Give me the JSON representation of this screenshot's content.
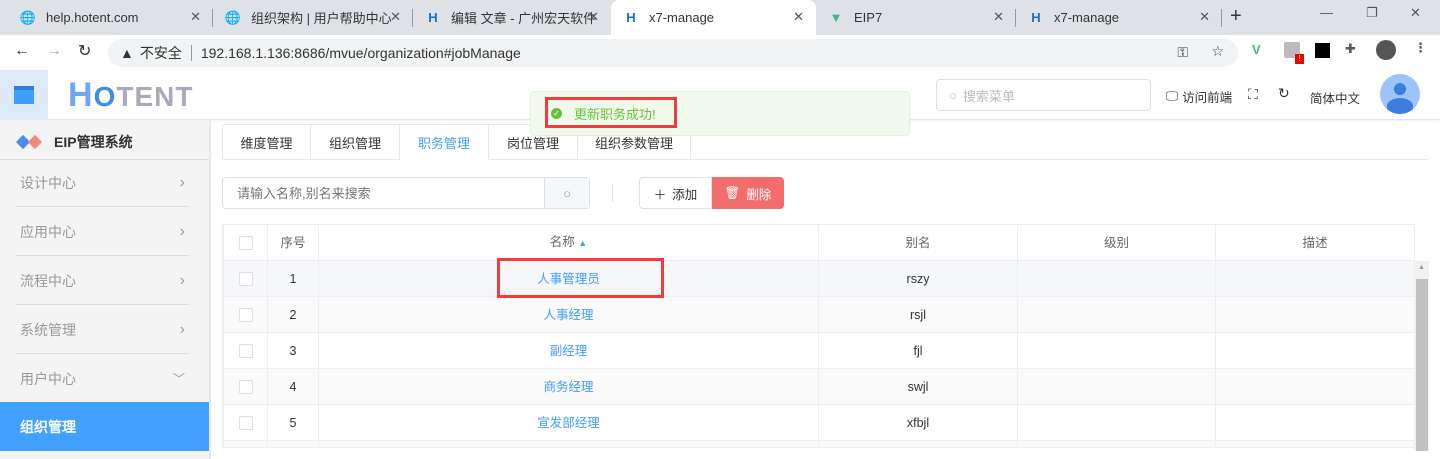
{
  "browser": {
    "tabs": [
      {
        "title": "help.hotent.com",
        "icon": "globe-icon"
      },
      {
        "title": "组织架构 | 用户帮助中心",
        "icon": "globe-icon"
      },
      {
        "title": "编辑 文章 - 广州宏天软件",
        "icon": "hotent-icon"
      },
      {
        "title": "x7-manage",
        "icon": "hotent-icon",
        "active": true
      },
      {
        "title": "EIP7",
        "icon": "vue-icon"
      },
      {
        "title": "x7-manage",
        "icon": "hotent-icon"
      }
    ],
    "security_label": "不安全",
    "url": "192.168.1.136:8686/mvue/organization#jobManage"
  },
  "header": {
    "logo": "HOTENT",
    "search_placeholder": "搜索菜单",
    "visit_frontend": "访问前端",
    "language": "简体中文"
  },
  "toast": {
    "message": "更新职务成功!",
    "color": "#67c23a"
  },
  "sidebar": {
    "title": "EIP管理系统",
    "items": [
      {
        "label": "设计中心",
        "chevron": "right"
      },
      {
        "label": "应用中心",
        "chevron": "right"
      },
      {
        "label": "流程中心",
        "chevron": "right"
      },
      {
        "label": "系统管理",
        "chevron": "right"
      },
      {
        "label": "用户中心",
        "chevron": "down"
      },
      {
        "label": "组织管理",
        "active": true
      }
    ]
  },
  "page_tabs": [
    "维度管理",
    "组织管理",
    "职务管理",
    "岗位管理",
    "组织参数管理"
  ],
  "active_tab": "职务管理",
  "toolbar": {
    "search_placeholder": "请输入名称,别名来搜索",
    "add_label": "添加",
    "delete_label": "删除"
  },
  "table": {
    "headers": [
      "序号",
      "名称",
      "别名",
      "级别",
      "描述"
    ],
    "rows": [
      {
        "no": "1",
        "name": "人事管理员",
        "alias": "rszy",
        "level": "",
        "desc": ""
      },
      {
        "no": "2",
        "name": "人事经理",
        "alias": "rsjl",
        "level": "",
        "desc": ""
      },
      {
        "no": "3",
        "name": "副经理",
        "alias": "fjl",
        "level": "",
        "desc": ""
      },
      {
        "no": "4",
        "name": "商务经理",
        "alias": "swjl",
        "level": "",
        "desc": ""
      },
      {
        "no": "5",
        "name": "宣发部经理",
        "alias": "xfbjl",
        "level": "",
        "desc": ""
      }
    ]
  },
  "colors": {
    "accent": "#409eff",
    "danger": "#f46d6d",
    "highlight_box": "#f03c3c"
  }
}
